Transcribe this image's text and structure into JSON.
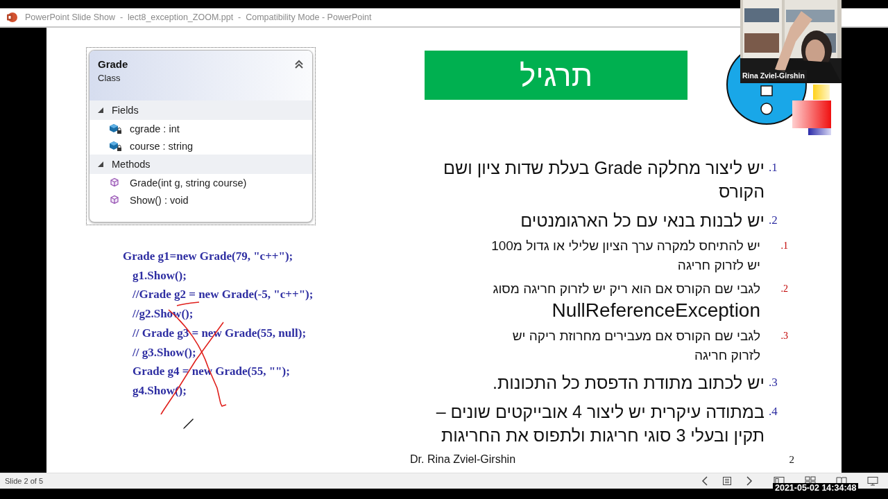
{
  "title_bar": {
    "title": "PowerPoint Slide Show  -  lect8_exception_ZOOM.ppt  -  Compatibility Mode - PowerPoint"
  },
  "slide": {
    "class_diagram": {
      "name": "Grade",
      "stereotype": "Class",
      "sections": [
        {
          "title": "Fields",
          "expanded": true,
          "members": [
            {
              "kind": "field",
              "text": "cgrade : int"
            },
            {
              "kind": "field",
              "text": "course : string"
            }
          ]
        },
        {
          "title": "Methods",
          "expanded": true,
          "members": [
            {
              "kind": "method",
              "text": "Grade(int g, string course)"
            },
            {
              "kind": "method",
              "text": "Show() : void"
            }
          ]
        }
      ]
    },
    "code_lines": [
      "Grade g1=new Grade(79, \"c++\");",
      "g1.Show();",
      "//Grade g2 = new Grade(-5, \"c++\");",
      "//g2.Show();",
      "// Grade g3 = new Grade(55, null);",
      "// g3.Show();",
      "Grade g4 = new Grade(55, \"\");",
      "g4.Show();"
    ],
    "title": "תרגיל",
    "items": [
      {
        "number": ".1",
        "text": "יש ליצור מחלקה Grade בעלת שדות ציון ושם הקורס"
      },
      {
        "number": ".2",
        "text": "יש לבנות בנאי עם כל הארגומנטים",
        "children": [
          {
            "number": ".1",
            "text": "יש להתיחס למקרה ערך הציון שלילי או גדול מ100 יש לזרוק חריגה"
          },
          {
            "number": ".2",
            "text": "לגבי שם הקורס אם הוא ריק יש לזרוק חריגה מסוג",
            "term": "NullReferenceException"
          },
          {
            "number": ".3",
            "text": "לגבי שם הקורס אם מעבירים מחרוזת ריקה יש לזרוק חריגה"
          }
        ]
      },
      {
        "number": ".3",
        "text": "יש לכתוב מתודת הדפסת כל התכונות."
      },
      {
        "number": ".4",
        "text": "במתודה עיקרית יש ליצור 4 אובייקטים שונים – תקין ובעלי 3 סוגי חריגות ולתפוס את החריגות"
      }
    ],
    "footer": "Dr. Rina Zviel-Girshin",
    "page_number": "2"
  },
  "status_bar": {
    "slide_counter": "Slide 2 of 5"
  },
  "video": {
    "kind": "picture",
    "name_label": "Rina Zviel-Girshin"
  },
  "timestamp": "2021-05-02 14:34:48"
}
